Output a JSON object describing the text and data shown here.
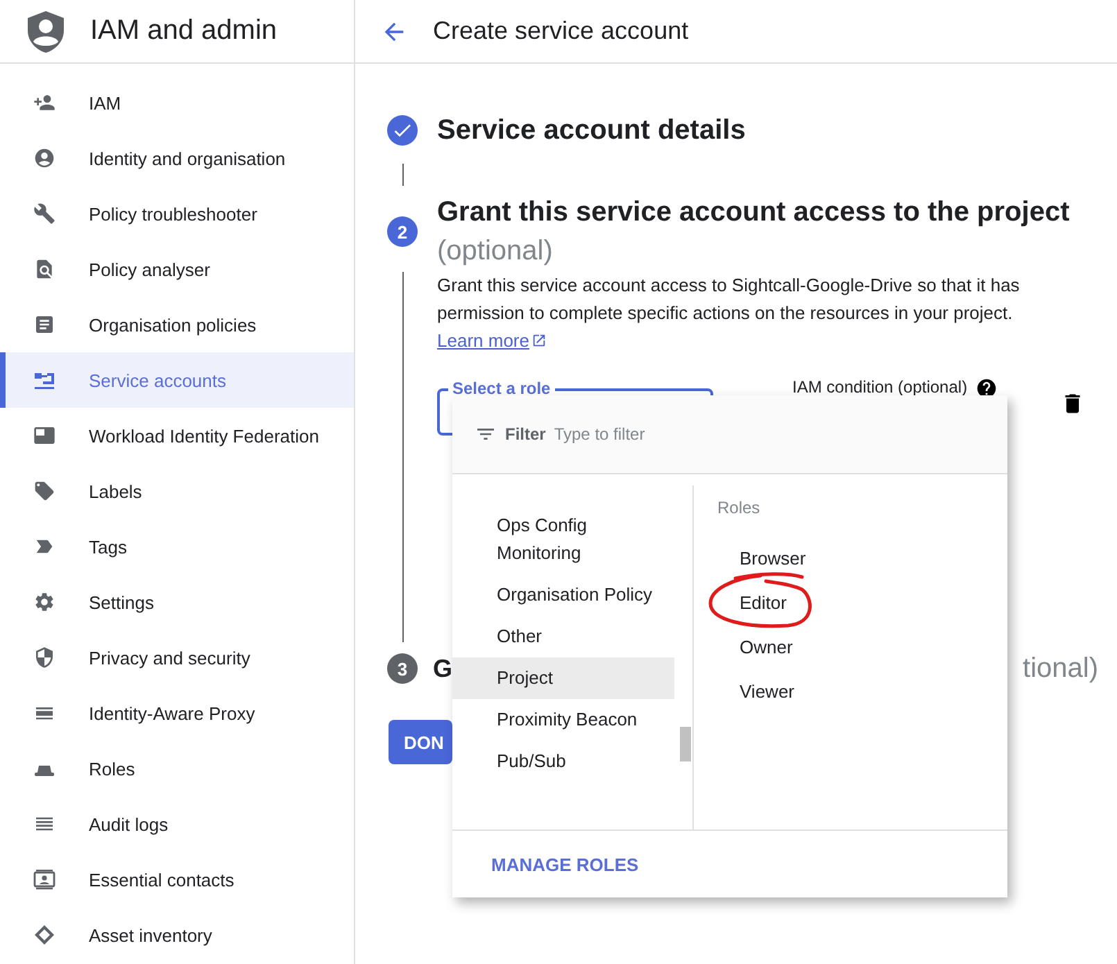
{
  "sidebar": {
    "title": "IAM and admin",
    "items": [
      {
        "label": "IAM",
        "selected": false
      },
      {
        "label": "Identity and organisation",
        "selected": false
      },
      {
        "label": "Policy troubleshooter",
        "selected": false
      },
      {
        "label": "Policy analyser",
        "selected": false
      },
      {
        "label": "Organisation policies",
        "selected": false
      },
      {
        "label": "Service accounts",
        "selected": true
      },
      {
        "label": "Workload Identity Federation",
        "selected": false
      },
      {
        "label": "Labels",
        "selected": false
      },
      {
        "label": "Tags",
        "selected": false
      },
      {
        "label": "Settings",
        "selected": false
      },
      {
        "label": "Privacy and security",
        "selected": false
      },
      {
        "label": "Identity-Aware Proxy",
        "selected": false
      },
      {
        "label": "Roles",
        "selected": false
      },
      {
        "label": "Audit logs",
        "selected": false
      },
      {
        "label": "Essential contacts",
        "selected": false
      },
      {
        "label": "Asset inventory",
        "selected": false
      }
    ]
  },
  "header": {
    "title": "Create service account"
  },
  "step_1": {
    "completed": true,
    "title": "Service account details"
  },
  "step_2": {
    "completed": false,
    "active": true,
    "number": "2",
    "title": "Grant this service account access to the project",
    "optional": "(optional)",
    "description": "Grant this service account access to Sightcall-Google-Drive so that it has permission to complete specific actions on the resources in your project.",
    "link": "Learn more",
    "role_field": {
      "label": "Select a role"
    },
    "condition_label": "IAM condition (optional)"
  },
  "step_3": {
    "completed": false,
    "active": false,
    "number": "3",
    "title_start": "G",
    "title_end": "tional)"
  },
  "done_button": "DON",
  "role_menu": {
    "filter_label": "Filter",
    "filter_placeholder": "Type to filter",
    "categories": [
      {
        "label": "Ops Config Monitoring",
        "selected": false
      },
      {
        "label": "Organisation Policy",
        "selected": false
      },
      {
        "label": "Other",
        "selected": false
      },
      {
        "label": "Project",
        "selected": true
      },
      {
        "label": "Proximity Beacon",
        "selected": false
      },
      {
        "label": "Pub/Sub",
        "selected": false
      }
    ],
    "roles_heading": "Roles",
    "roles": [
      "Browser",
      "Editor",
      "Owner",
      "Viewer"
    ],
    "manage_button": "MANAGE ROLES"
  }
}
